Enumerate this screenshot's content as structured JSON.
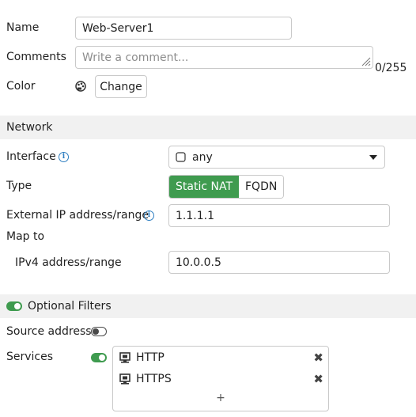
{
  "form": {
    "name_label": "Name",
    "name_value": "Web-Server1",
    "comments_label": "Comments",
    "comments_placeholder": "Write a comment...",
    "comments_counter": "0/255",
    "color_label": "Color",
    "color_change_button": "Change"
  },
  "network": {
    "section_title": "Network",
    "interface_label": "Interface",
    "interface_value": "any",
    "type_label": "Type",
    "type_options": [
      "Static NAT",
      "FQDN"
    ],
    "type_selected": "Static NAT",
    "external_ip_label": "External IP address/range",
    "external_ip_value": "1.1.1.1",
    "map_to_label": "Map to",
    "ipv4_label": "IPv4 address/range",
    "ipv4_value": "10.0.0.5"
  },
  "filters": {
    "section_title": "Optional Filters",
    "enabled": true,
    "source_address_label": "Source address",
    "source_address_enabled": false,
    "services_label": "Services",
    "services_enabled": true,
    "services": [
      "HTTP",
      "HTTPS"
    ],
    "add_symbol": "+"
  },
  "colors": {
    "accent_green": "#3f9b4f",
    "info_blue": "#2f7fc1"
  }
}
